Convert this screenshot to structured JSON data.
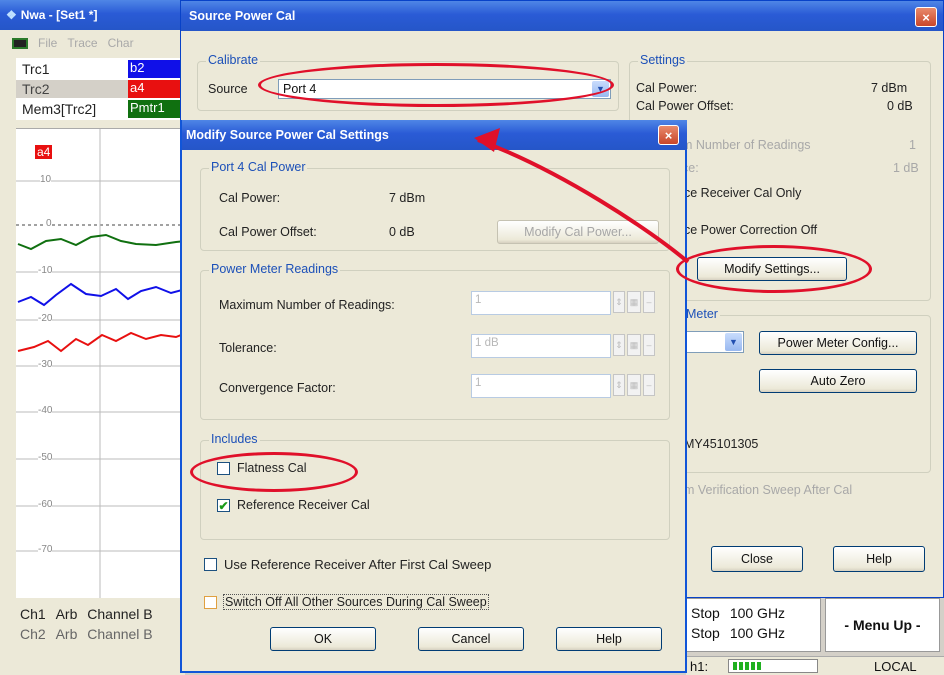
{
  "app": {
    "title": "Nwa - [Set1 *]",
    "menu": [
      "File",
      "Trace",
      "Char"
    ],
    "traces": [
      {
        "name": "Trc1",
        "meas": "b2",
        "color": "#1010e8"
      },
      {
        "name": "Trc2",
        "meas": "a4",
        "color": "#e81010"
      },
      {
        "name": "Mem3[Trc2]",
        "meas": "Pmtr1",
        "color": "#107010"
      }
    ],
    "chart": {
      "marker_label": "a4",
      "ticks": [
        "10",
        "0",
        "-10",
        "-20",
        "-30",
        "-40",
        "-50",
        "-60",
        "-70"
      ]
    },
    "channels": [
      {
        "label": "Ch1",
        "mode": "Arb",
        "name": "Channel B"
      },
      {
        "label": "Ch2",
        "mode": "Arb",
        "name": "Channel B"
      }
    ],
    "stops": [
      {
        "label": "Stop",
        "value": "100 GHz"
      },
      {
        "label": "Stop",
        "value": "100 GHz"
      }
    ],
    "menu_up": "- Menu Up -",
    "status_ch": "h1:",
    "status_local": "LOCAL"
  },
  "source_power_cal": {
    "title": "Source Power Cal",
    "close": "×",
    "calibrate": {
      "group": "Calibrate",
      "source_label": "Source",
      "source_value": "Port 4"
    },
    "settings": {
      "group": "Settings",
      "cal_power_label": "Cal Power:",
      "cal_power_value": "7 dBm",
      "offset_label": "Cal Power Offset:",
      "offset_value": "0 dB",
      "max_readings_label": "m Number of Readings",
      "max_readings_value": "1",
      "tolerance_label": "ce:",
      "tolerance_value": "1 dB",
      "ref_only": "ce Receiver Cal Only",
      "correction_off": "ce Power Correction Off",
      "modify_button": "Modify Settings..."
    },
    "meter": {
      "group": "Meter",
      "config_button": "Power Meter Config...",
      "autozero_button": "Auto Zero",
      "serial": "MY45101305"
    },
    "verification": "m Verification Sweep After Cal",
    "close_button": "Close",
    "help_button": "Help"
  },
  "modify_dialog": {
    "title": "Modify Source Power Cal Settings",
    "close": "×",
    "port_group": "Port 4 Cal Power",
    "cal_power_label": "Cal Power:",
    "cal_power_value": "7 dBm",
    "offset_label": "Cal Power Offset:",
    "offset_value": "0 dB",
    "modify_cal_power": "Modify Cal Power...",
    "readings_group": "Power Meter Readings",
    "max_readings_label": "Maximum Number of Readings:",
    "max_readings_value": "1",
    "tolerance_label": "Tolerance:",
    "tolerance_value": "1 dB",
    "convergence_label": "Convergence Factor:",
    "convergence_value": "1",
    "includes_group": "Includes",
    "flatness_label": "Flatness Cal",
    "flatness_checked": false,
    "ref_receiver_label": "Reference Receiver Cal",
    "ref_receiver_checked": true,
    "use_ref_label": "Use Reference Receiver After First Cal Sweep",
    "switch_off_label": "Switch Off All Other Sources During Cal Sweep",
    "ok": "OK",
    "cancel": "Cancel",
    "help": "Help"
  },
  "annotation_color": "#e0102a"
}
